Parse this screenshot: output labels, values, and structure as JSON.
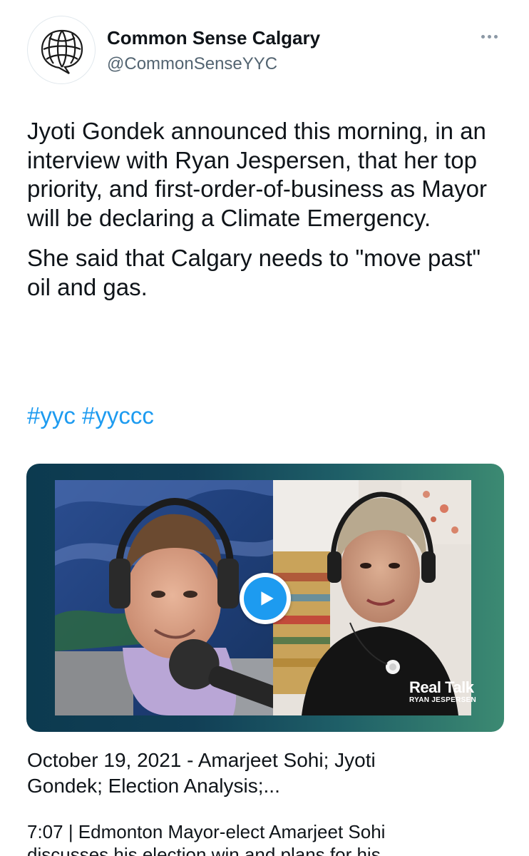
{
  "tweet": {
    "author": {
      "display_name": "Common Sense Calgary",
      "handle": "@CommonSenseYYC",
      "avatar_icon": "speech-bubble-web-logo-icon"
    },
    "more_icon": "more-options-icon",
    "paragraphs": [
      "Jyoti Gondek announced this morning, in an interview with Ryan Jespersen, that her top priority, and first-order-of-business as Mayor will be declaring a Climate Emergency.",
      "She said that Calgary needs to \"move past\" oil and gas."
    ],
    "hashtags": [
      "#yyc",
      "#yyccc"
    ],
    "link_color": "#1d9bf0"
  },
  "media_card": {
    "play_icon": "play-icon",
    "brand_title": "Real Talk",
    "brand_subtitle": "RYAN JESPERSEN",
    "title_line1": "October 19, 2021 - Amarjeet Sohi; Jyoti",
    "title_line2": "Gondek; Election Analysis;...",
    "description_line1": "7:07 | Edmonton Mayor-elect Amarjeet Sohi",
    "description_line2": "discusses his election win and plans for his"
  }
}
